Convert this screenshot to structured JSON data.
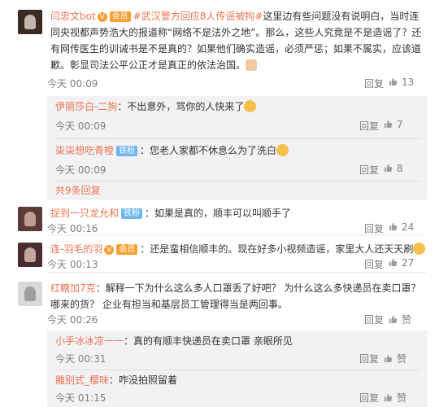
{
  "comments": [
    {
      "user": "闫忠文bot",
      "badge": "会员",
      "topic": "#武汉警方回应8人传谣被拘#",
      "text": "这里边有些问题没有说明白，当时连同央视都声势浩大的报道称“网络不是法外之地”。那么，这些人究竟是不是造谣了？还有网传医生的训诫书是不是真的？如果他们确实造谣，必须严惩；如果不属实，应该道歉。彰显司法公平公正才是真正的依法治国。",
      "time": "今天 00:09",
      "reply": "回复",
      "likes": "13",
      "replies": [
        {
          "user": "伊丽莎白-二狗",
          "text": "：不出意外，骂你的人快来了",
          "time": "今天 00:09",
          "reply": "回复",
          "likes": "7"
        },
        {
          "user": "柒柒想吃青橙",
          "badge": "铁粉",
          "text": "：您老人家都不休息么为了洗白",
          "time": "今天 00:09",
          "reply": "回复",
          "likes": "8"
        }
      ],
      "more": "共9条回复"
    },
    {
      "user": "捉到一只龙允和",
      "badge": "铁粉",
      "text": "：如果是真的，顺丰可以叫顺手了",
      "time": "今天 00:16",
      "reply": "回复",
      "likes": "24"
    },
    {
      "user": "连-羽毛的羽",
      "badge": "会员",
      "text": "：还是蛮相信顺丰的。现在好多小视频造谣，家里大人还天天刷",
      "time": "今天 00:13",
      "reply": "回复",
      "likes": "27"
    },
    {
      "user": "红糖加7克",
      "text": "：解释一下为什么这么多人口罩丢了好吧？ 为什么这么多快递员在卖口罩？哪来的货？ 企业有担当和基层员工管理得当是两回事。",
      "time": "今天 00:26",
      "reply": "回复",
      "likes": "赞",
      "replies": [
        {
          "user": "小手冰冰凉一一",
          "text": "：真的有顺丰快递员在卖口罩 亲眼所见",
          "time": "今天 00:31",
          "reply": "回复",
          "likes": "赞"
        },
        {
          "user": "離别式_樱味",
          "text": "：咋没拍照留着",
          "time": "今天 01:15",
          "reply": "回复",
          "likes": "赞"
        }
      ]
    }
  ],
  "colors": {
    "accent": "#eb7350",
    "sub_bg": "#f2f2f5",
    "meta": "#808080"
  },
  "icons": {
    "like": "thumb-up-icon",
    "vip": "vip-icon"
  }
}
